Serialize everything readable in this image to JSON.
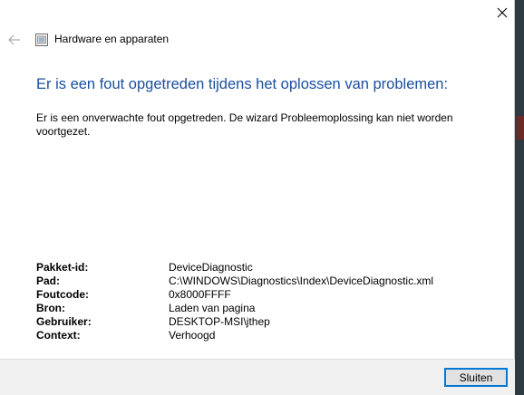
{
  "window": {
    "title": "Hardware en apparaten",
    "close_icon": "close-icon",
    "back_icon": "back-arrow-icon",
    "app_icon": "troubleshooter-icon"
  },
  "error": {
    "heading": "Er is een fout opgetreden tijdens het oplossen van problemen:",
    "message": "Er is een onverwachte fout opgetreden. De wizard Probleemoplossing kan niet worden voortgezet."
  },
  "details": [
    {
      "label": "Pakket-id:",
      "value": "DeviceDiagnostic"
    },
    {
      "label": "Pad:",
      "value": "C:\\WINDOWS\\Diagnostics\\Index\\DeviceDiagnostic.xml"
    },
    {
      "label": "Foutcode:",
      "value": "0x8000FFFF"
    },
    {
      "label": "Bron:",
      "value": "Laden van pagina"
    },
    {
      "label": "Gebruiker:",
      "value": "DESKTOP-MSI\\jthep"
    },
    {
      "label": "Context:",
      "value": "Verhoogd"
    }
  ],
  "footer": {
    "close_label": "Sluiten"
  },
  "colors": {
    "heading": "#1a4fa0",
    "button_border": "#0078d7",
    "footer_bg": "#f0f0f0"
  }
}
